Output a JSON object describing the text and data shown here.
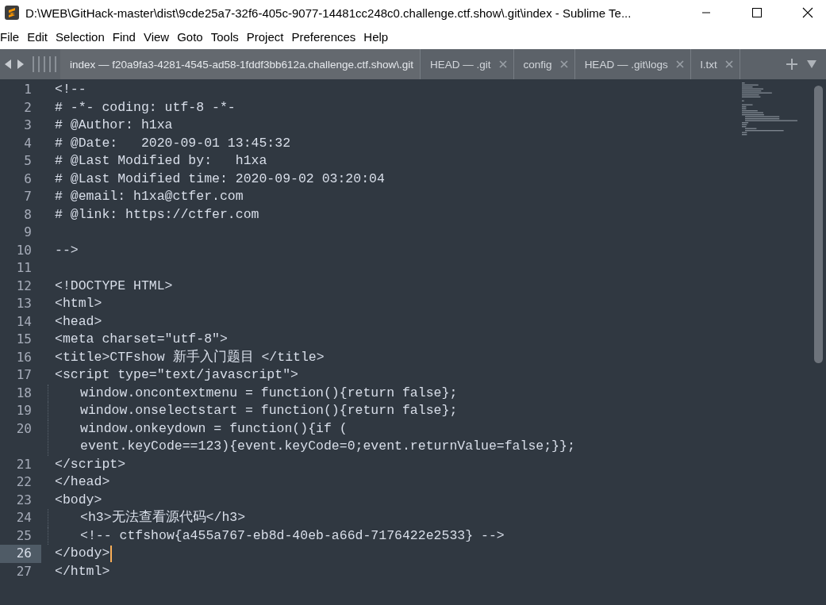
{
  "window": {
    "title": "D:\\WEB\\GitHack-master\\dist\\9cde25a7-32f6-405c-9077-14481cc248c0.challenge.ctf.show\\.git\\index - Sublime Te..."
  },
  "menu": [
    "File",
    "Edit",
    "Selection",
    "Find",
    "View",
    "Goto",
    "Tools",
    "Project",
    "Preferences",
    "Help"
  ],
  "tabs": [
    {
      "label": "index — f20a9fa3-4281-4545-ad58-1fddf3bb612a.challenge.ctf.show\\.git",
      "selected": true,
      "closable": false
    },
    {
      "label": "HEAD — .git",
      "selected": false,
      "closable": true
    },
    {
      "label": "config",
      "selected": false,
      "closable": true
    },
    {
      "label": "HEAD — .git\\logs",
      "selected": false,
      "closable": true
    },
    {
      "label": "l.txt",
      "selected": false,
      "closable": true
    }
  ],
  "lines": [
    {
      "number": "1",
      "text": "<!--",
      "indent": false,
      "selected": false
    },
    {
      "number": "2",
      "text": "# -*- coding: utf-8 -*-",
      "indent": false,
      "selected": false
    },
    {
      "number": "3",
      "text": "# @Author: h1xa",
      "indent": false,
      "selected": false
    },
    {
      "number": "4",
      "text": "# @Date:   2020-09-01 13:45:32",
      "indent": false,
      "selected": false
    },
    {
      "number": "5",
      "text": "# @Last Modified by:   h1xa",
      "indent": false,
      "selected": false
    },
    {
      "number": "6",
      "text": "# @Last Modified time: 2020-09-02 03:20:04",
      "indent": false,
      "selected": false
    },
    {
      "number": "7",
      "text": "# @email: h1xa@ctfer.com",
      "indent": false,
      "selected": false
    },
    {
      "number": "8",
      "text": "# @link: https://ctfer.com",
      "indent": false,
      "selected": false
    },
    {
      "number": "9",
      "indent": false,
      "selected": false
    },
    {
      "number": "10",
      "text": "-->",
      "indent": false,
      "selected": false
    },
    {
      "number": "11",
      "indent": false,
      "selected": false
    },
    {
      "number": "12",
      "text": "<!DOCTYPE HTML>",
      "indent": false,
      "selected": false
    },
    {
      "number": "13",
      "text": "<html>",
      "indent": false,
      "selected": false
    },
    {
      "number": "14",
      "text": "<head>",
      "indent": false,
      "selected": false
    },
    {
      "number": "15",
      "text": "<meta charset=\"utf-8\">",
      "indent": false,
      "selected": false
    },
    {
      "number": "16",
      "text": "<title>CTFshow 新手入门题目 </title>",
      "indent": false,
      "selected": false
    },
    {
      "number": "17",
      "text": "<script type=\"text/javascript\">",
      "indent": false,
      "selected": false
    },
    {
      "number": "18",
      "text": "window.oncontextmenu = function(){return false};",
      "indent": true,
      "selected": false
    },
    {
      "number": "19",
      "text": "window.onselectstart = function(){return false};",
      "indent": true,
      "selected": false
    },
    {
      "number": "20",
      "text": "window.onkeydown = function(){if (",
      "continuation": "event.keyCode==123){event.keyCode=0;event.returnValue=false;}};",
      "indent": true,
      "selected": false
    },
    {
      "number": "21",
      "text": "</script>",
      "indent": false,
      "selected": false
    },
    {
      "number": "22",
      "text": "</head>",
      "indent": false,
      "selected": false
    },
    {
      "number": "23",
      "text": "<body>",
      "indent": false,
      "selected": false
    },
    {
      "number": "24",
      "text": "<h3>无法查看源代码</h3>",
      "indent": true,
      "selected": false
    },
    {
      "number": "25",
      "text": "<!-- ctfshow{a455a767-eb8d-40eb-a66d-7176422e2533} -->",
      "indent": true,
      "selected": false
    },
    {
      "number": "26",
      "text": "</body>",
      "indent": false,
      "selected": true
    },
    {
      "number": "27",
      "text": "</html>",
      "indent": false,
      "selected": false
    }
  ]
}
